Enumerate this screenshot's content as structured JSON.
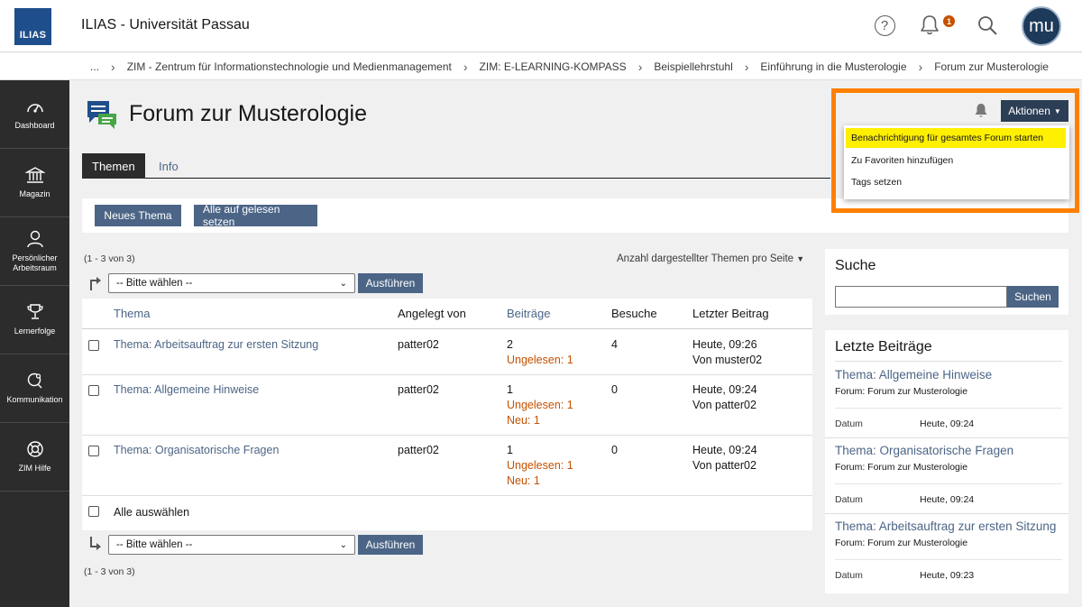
{
  "header": {
    "logo_text": "ILIAS",
    "site_title": "ILIAS - Universität Passau",
    "help_glyph": "?",
    "notification_count": "1",
    "avatar_initials": "mu",
    "icons": [
      "help-icon",
      "bell-icon",
      "search-icon"
    ]
  },
  "breadcrumb": {
    "items": [
      "...",
      "ZIM - Zentrum für Informationstechnologie und Medienmanagement",
      "ZIM: E-LEARNING-KOMPASS",
      "Beispiellehrstuhl",
      "Einführung in die Musterologie",
      "Forum zur Musterologie"
    ]
  },
  "mainbar": {
    "items": [
      {
        "label": "Dashboard",
        "icon": "dashboard-icon"
      },
      {
        "label": "Magazin",
        "icon": "magazin-icon"
      },
      {
        "label": "Persönlicher Arbeitsraum",
        "icon": "user-icon"
      },
      {
        "label": "Lernerfolge",
        "icon": "trophy-icon"
      },
      {
        "label": "Kommunikation",
        "icon": "chat-icon"
      },
      {
        "label": "ZIM Hilfe",
        "icon": "lifebuoy-icon"
      }
    ]
  },
  "page": {
    "title": "Forum zur Musterologie",
    "tabs": [
      "Themen",
      "Info"
    ]
  },
  "toolbar": {
    "new_topic": "Neues Thema",
    "mark_all_read": "Alle auf gelesen setzen"
  },
  "table": {
    "pager_top": "(1 - 3 von 3)",
    "pager_bottom": "(1 - 3 von 3)",
    "per_page_label": "Anzahl dargestellter Themen pro Seite",
    "select_placeholder": "-- Bitte wählen --",
    "execute_label": "Ausführen",
    "select_all_label": "Alle auswählen",
    "columns": [
      "Thema",
      "Angelegt von",
      "Beiträge",
      "Besuche",
      "Letzter Beitrag"
    ],
    "rows": [
      {
        "topic": "Thema: Arbeitsauftrag zur ersten Sitzung",
        "author": "patter02",
        "posts": "2",
        "unread": "Ungelesen: 1",
        "new": "",
        "visits": "4",
        "last_time": "Heute, 09:26",
        "last_by": "Von muster02"
      },
      {
        "topic": "Thema: Allgemeine Hinweise",
        "author": "patter02",
        "posts": "1",
        "unread": "Ungelesen: 1",
        "new": "Neu: 1",
        "visits": "0",
        "last_time": "Heute, 09:24",
        "last_by": "Von patter02"
      },
      {
        "topic": "Thema: Organisatorische Fragen",
        "author": "patter02",
        "posts": "1",
        "unread": "Ungelesen: 1",
        "new": "Neu: 1",
        "visits": "0",
        "last_time": "Heute, 09:24",
        "last_by": "Von patter02"
      }
    ]
  },
  "search_panel": {
    "title": "Suche",
    "button": "Suchen"
  },
  "recent_panel": {
    "title": "Letzte Beiträge",
    "date_label": "Datum",
    "items": [
      {
        "title": "Thema: Allgemeine Hinweise",
        "forum": "Forum: Forum zur Musterologie",
        "date": "Heute, 09:24"
      },
      {
        "title": "Thema: Organisatorische Fragen",
        "forum": "Forum: Forum zur Musterologie",
        "date": "Heute, 09:24"
      },
      {
        "title": "Thema: Arbeitsauftrag zur ersten Sitzung",
        "forum": "Forum: Forum zur Musterologie",
        "date": "Heute, 09:23"
      }
    ]
  },
  "actions": {
    "button_label": "Aktionen",
    "menu": [
      {
        "label": "Benachrichtigung für gesamtes Forum starten",
        "highlighted": true
      },
      {
        "label": "Zu Favoriten hinzufügen",
        "highlighted": false
      },
      {
        "label": "Tags setzen",
        "highlighted": false
      }
    ]
  },
  "colors": {
    "accent": "#4c6586",
    "nav_bg": "#2c2c2c",
    "highlight_frame": "#ff8000",
    "menu_highlight": "#ffef00",
    "unread": "#c65100"
  }
}
